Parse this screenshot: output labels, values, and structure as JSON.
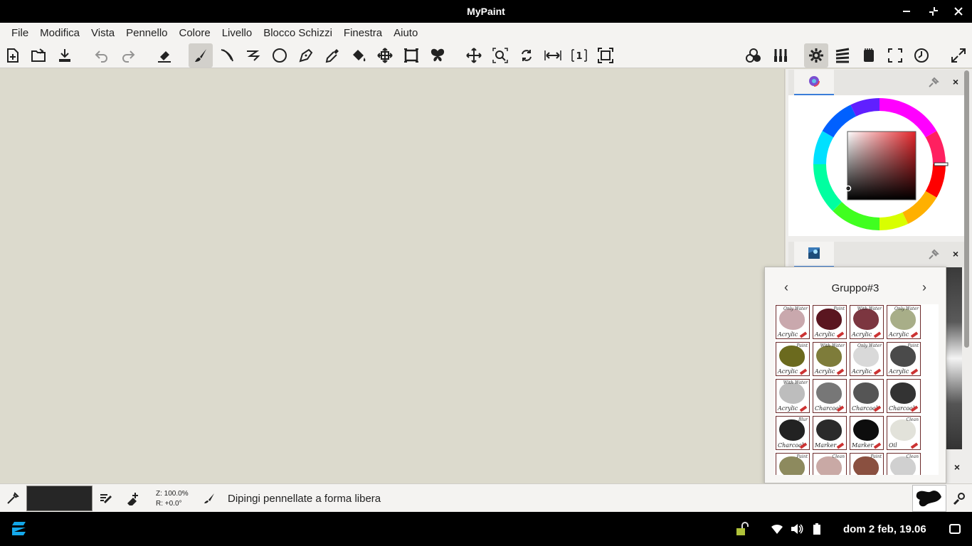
{
  "window": {
    "title": "MyPaint",
    "controls": [
      "minimize-icon",
      "restore-icon",
      "close-icon"
    ]
  },
  "menu": [
    "File",
    "Modifica",
    "Vista",
    "Pennello",
    "Colore",
    "Livello",
    "Blocco Schizzi",
    "Finestra",
    "Aiuto"
  ],
  "toolbar": {
    "file": [
      "new-file-icon",
      "open-file-icon",
      "save-file-icon"
    ],
    "history": [
      "undo-icon",
      "redo-icon"
    ],
    "tools": [
      "eraser-icon",
      "freehand-brush-icon",
      "inking-icon",
      "connected-lines-icon",
      "ellipse-icon",
      "pen-icon",
      "color-picker-icon",
      "fill-icon",
      "move-layer-icon",
      "frame-icon",
      "symmetry-icon"
    ],
    "view": [
      "pan-icon",
      "zoom-icon",
      "rotate-icon",
      "mirror-icon",
      "one-to-one-icon",
      "fit-view-icon"
    ],
    "right": [
      "color-mix-icon",
      "brushes-icon",
      "settings-icon",
      "layers-icon",
      "scratchpad-icon",
      "fullscreen-icon",
      "history-clock-icon",
      "expand-icon"
    ],
    "active_tool": "freehand-brush-icon"
  },
  "colors": {
    "canvas": "#dcdacd",
    "current_color": "#262626",
    "accent": "#3b7dd8",
    "brush_border": "#6c2a2a"
  },
  "dock": {
    "color_panel": {
      "tab_icon": "color-wheel-icon",
      "pin_icon": "pin-icon",
      "close": "×"
    },
    "brush_panel": {
      "tab_icon": "brush-group-icon",
      "pin_icon": "pin-icon",
      "close": "×"
    },
    "third_close": "×"
  },
  "brush_popover": {
    "title": "Gruppo#3",
    "prev": "‹",
    "next": "›",
    "brushes": [
      {
        "label": "Acrylic",
        "tag": "Only Water",
        "color": "#c9a8ad"
      },
      {
        "label": "Acrylic",
        "tag": "Paint",
        "color": "#5a1620"
      },
      {
        "label": "Acrylic",
        "tag": "With Water",
        "color": "#7c3640"
      },
      {
        "label": "Acrylic",
        "tag": "Only Water",
        "color": "#a8ae88"
      },
      {
        "label": "Acrylic",
        "tag": "Paint",
        "color": "#6b6a1e"
      },
      {
        "label": "Acrylic",
        "tag": "With Water",
        "color": "#7e7c3a"
      },
      {
        "label": "Acrylic",
        "tag": "Only Water",
        "color": "#d9d9d9"
      },
      {
        "label": "Acrylic",
        "tag": "Paint",
        "color": "#4a4a4a"
      },
      {
        "label": "Acrylic",
        "tag": "With Water",
        "color": "#bdbdbd"
      },
      {
        "label": "Charcoal",
        "tag": "",
        "color": "#777777"
      },
      {
        "label": "Charcoal",
        "tag": "",
        "color": "#555555"
      },
      {
        "label": "Charcoal",
        "tag": "",
        "color": "#333333"
      },
      {
        "label": "Charcoal",
        "tag": "Blur",
        "color": "#222222"
      },
      {
        "label": "Marker",
        "tag": "",
        "color": "#2a2a2a"
      },
      {
        "label": "Marker",
        "tag": "",
        "color": "#0d0d0d"
      },
      {
        "label": "Oil",
        "tag": "Clean",
        "color": "#e2e2da"
      },
      {
        "label": "",
        "tag": "Paint",
        "color": "#8d8a5e"
      },
      {
        "label": "",
        "tag": "Clean",
        "color": "#c9a9a5"
      },
      {
        "label": "",
        "tag": "Paint",
        "color": "#8a5040"
      },
      {
        "label": "",
        "tag": "Clean",
        "color": "#d0d0d0"
      }
    ]
  },
  "statusbar": {
    "picker_icon": "eyedropper-icon",
    "edit_icon": "edit-color-icon",
    "add_layer_icon": "add-layer-icon",
    "zoom": "Z: 100.0%",
    "rotation": "R: +0.0°",
    "mode_icon": "brush-icon",
    "message": "Dipingi pennellate a forma libera",
    "brush_settings_icon": "brush-settings-icon"
  },
  "taskbar": {
    "launcher_icon": "zorin-logo-icon",
    "tray": [
      "unlock-icon",
      "wifi-icon",
      "volume-icon",
      "battery-icon"
    ],
    "clock": "dom  2 feb, 19.06",
    "show_desktop_icon": "show-desktop-icon"
  }
}
